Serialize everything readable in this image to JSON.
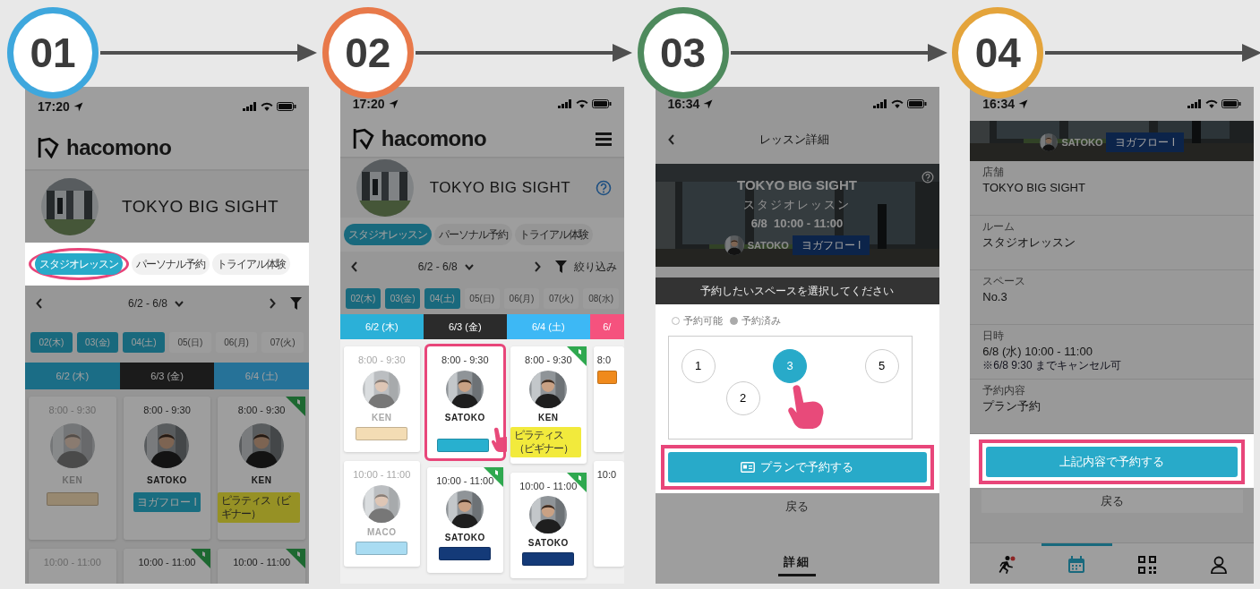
{
  "steps": [
    {
      "number": "01",
      "color": "#3ea7dd",
      "screen": {
        "kind": "schedule",
        "lit": {
          "header": false,
          "categories": true,
          "controls": false,
          "schedule": false
        },
        "time": "17:20",
        "brand": "hacomono",
        "studio": "TOKYO BIG SIGHT",
        "categories": [
          {
            "label": "スタジオレッスン",
            "selected": true,
            "highlighted": true
          },
          {
            "label": "パーソナル予約",
            "selected": false,
            "highlighted": false
          },
          {
            "label": "トライアル体験",
            "selected": false,
            "highlighted": false
          }
        ],
        "range": "6/2 - 6/8",
        "day_chips": [
          {
            "label": "02(木)",
            "available": true
          },
          {
            "label": "03(金)",
            "available": true
          },
          {
            "label": "04(土)",
            "available": true
          },
          {
            "label": "05(日)",
            "available": false
          },
          {
            "label": "06(月)",
            "available": false
          },
          {
            "label": "07(火)",
            "available": false
          }
        ],
        "columns": [
          {
            "header": "6/2 (木)",
            "color": "#1b6d86",
            "clipped": false,
            "cards": [
              {
                "time": "8:00 - 9:30",
                "instructor": "KEN",
                "tag": {
                  "color": "#978870"
                },
                "past": true,
                "flag": false,
                "highlighted": false
              },
              {
                "time": "10:00 - 11:00",
                "past": true,
                "flag": false,
                "highlighted": false
              }
            ]
          },
          {
            "header": "6/3 (金)",
            "color": "#1b1b1b",
            "clipped": false,
            "cards": [
              {
                "time": "8:00 - 9:30",
                "instructor": "SATOKO",
                "tag": {
                  "label": "ヨガフロー I",
                  "color": "#196d80"
                },
                "past": false,
                "flag": false,
                "highlighted": false
              },
              {
                "time": "10:00 - 11:00",
                "past": false,
                "flag": true,
                "highlighted": false
              }
            ]
          },
          {
            "header": "6/4 (土)",
            "color": "#267298",
            "clipped": false,
            "cards": [
              {
                "time": "8:00 - 9:30",
                "instructor": "KEN",
                "tag": {
                  "label": "ピラティス（ビギナー）",
                  "color": "#969125"
                },
                "past": false,
                "flag": true,
                "highlighted": false
              },
              {
                "time": "10:00 - 11:00",
                "past": false,
                "flag": true,
                "highlighted": false
              }
            ]
          }
        ]
      }
    },
    {
      "number": "02",
      "color": "#e8794a",
      "screen": {
        "kind": "schedule",
        "lit": {
          "header": false,
          "categories": false,
          "controls": false,
          "schedule": true
        },
        "time": "17:20",
        "brand": "hacomono",
        "menu": true,
        "studio": "TOKYO BIG SIGHT",
        "help": true,
        "categories": [
          {
            "label": "スタジオレッスン",
            "selected": true,
            "highlighted": false
          },
          {
            "label": "パーソナル予約",
            "selected": false,
            "highlighted": false
          },
          {
            "label": "トライアル体験",
            "selected": false,
            "highlighted": false
          }
        ],
        "range": "6/2 - 6/8",
        "filter_label": "絞り込み",
        "day_chips": [
          {
            "label": "02(木)",
            "available": true
          },
          {
            "label": "03(金)",
            "available": true
          },
          {
            "label": "04(土)",
            "available": true
          },
          {
            "label": "05(日)",
            "available": false
          },
          {
            "label": "06(月)",
            "available": false
          },
          {
            "label": "07(火)",
            "available": false
          },
          {
            "label": "08(水)",
            "available": false
          }
        ],
        "columns": [
          {
            "header": "6/2 (木)",
            "color": "#2bb0d8",
            "clipped": false,
            "cards": [
              {
                "time": "8:00 - 9:30",
                "instructor": "KEN",
                "tag": {
                  "color": "#f3dcb4"
                },
                "past": true,
                "flag": false,
                "highlighted": false
              },
              {
                "time": "10:00 - 11:00",
                "instructor": "MACO",
                "tag": {
                  "color": "#a9dcf2"
                },
                "past": true,
                "flag": false,
                "highlighted": false
              }
            ]
          },
          {
            "header": "6/3 (金)",
            "color": "#2b2b2b",
            "clipped": false,
            "cards": [
              {
                "time": "8:00 - 9:30",
                "instructor": "SATOKO",
                "tag": {
                  "color": "#28b0cf"
                },
                "past": false,
                "flag": false,
                "highlighted": true
              },
              {
                "time": "10:00 - 11:00",
                "instructor": "SATOKO",
                "tag": {
                  "color": "#143a78"
                },
                "past": false,
                "flag": true,
                "highlighted": false
              }
            ]
          },
          {
            "header": "6/4 (土)",
            "color": "#3db8f5",
            "clipped": false,
            "cards": [
              {
                "time": "8:00 - 9:30",
                "instructor": "KEN",
                "tag": {
                  "label": "ピラティス（ビギナー）",
                  "color": "#f2ea3c"
                },
                "past": false,
                "flag": true,
                "highlighted": false
              },
              {
                "time": "10:00 - 11:00",
                "instructor": "SATOKO",
                "tag": {
                  "color": "#143a78"
                },
                "past": false,
                "flag": true,
                "highlighted": false
              }
            ]
          },
          {
            "header": "6/",
            "color": "#f5527e",
            "clipped": true,
            "cards": [
              {
                "time": "8:0",
                "tag": {
                  "color": "#f08a1c"
                },
                "past": false,
                "flag": false,
                "highlighted": false
              },
              {
                "time": "10:0",
                "past": false,
                "flag": false,
                "highlighted": false
              }
            ]
          }
        ]
      }
    },
    {
      "number": "03",
      "color": "#4e8a5d",
      "screen": {
        "kind": "detail",
        "lit": {
          "header": false,
          "seats": true,
          "footer": false
        },
        "time": "16:34",
        "title": "レッスン詳細",
        "hero": {
          "studio": "TOKYO BIG SIGHT",
          "room": "スタジオレッスン",
          "datetime": "6/8  10:00 - 11:00",
          "instructor": "SATOKO",
          "tag": "ヨガフロー I"
        },
        "prompt": "予約したいスペースを選択してください",
        "legend": [
          {
            "label": "予約可能",
            "kind": "open"
          },
          {
            "label": "予約済み",
            "kind": "taken"
          }
        ],
        "seat_rows": [
          {
            "seats": [
              {
                "label": "1",
                "selected": false
              },
              {
                "label": "3",
                "selected": true
              },
              {
                "label": "5",
                "selected": false
              }
            ]
          },
          {
            "seats": [
              {
                "label": "2",
                "selected": false
              }
            ]
          }
        ],
        "button": {
          "label": "プランで予約する",
          "highlighted": true
        },
        "back": "戻る",
        "tab": "詳細"
      }
    },
    {
      "number": "04",
      "color": "#e4a43b",
      "screen": {
        "kind": "confirm",
        "lit": {
          "header": false,
          "fields": false,
          "button": true,
          "footer": false
        },
        "time": "16:34",
        "hero": {
          "instructor": "SATOKO",
          "tag": "ヨガフロー I"
        },
        "fields": [
          {
            "label": "店舗",
            "value": "TOKYO BIG SIGHT"
          },
          {
            "label": "ルーム",
            "value": "スタジオレッスン"
          },
          {
            "label": "スペース",
            "value": "No.3"
          },
          {
            "label": "日時",
            "value": "6/8 (水) 10:00 - 11:00",
            "note": "※6/8 9:30 までキャンセル可"
          },
          {
            "label": "予約内容",
            "value": "プラン予約"
          }
        ],
        "button": {
          "label": "上記内容で予約する",
          "highlighted": true
        },
        "back": "戻る",
        "nav": [
          {
            "kind": "activity",
            "selected": false
          },
          {
            "kind": "calendar",
            "selected": true
          },
          {
            "kind": "code",
            "selected": false
          },
          {
            "kind": "account",
            "selected": false
          }
        ]
      }
    }
  ]
}
